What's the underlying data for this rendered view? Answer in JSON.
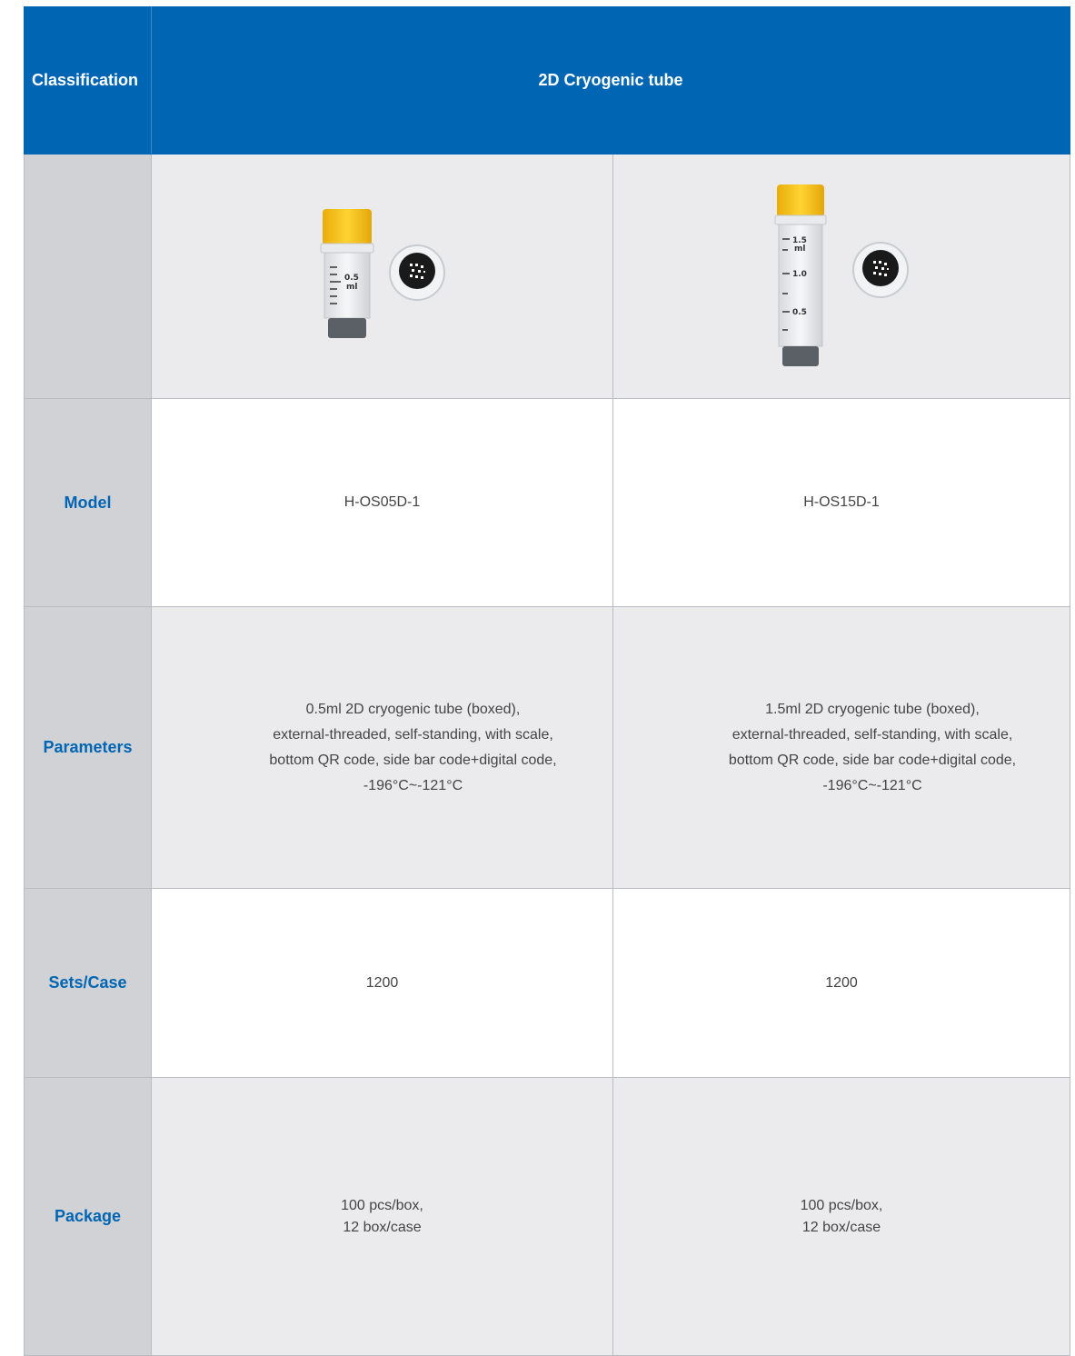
{
  "table": {
    "classification_label": "Classification",
    "product_title": "2D Cryogenic tube",
    "rows": {
      "model": {
        "label": "Model",
        "values": [
          "H-OS05D-1",
          "H-OS15D-1"
        ]
      },
      "parameters": {
        "label": "Parameters",
        "values": [
          "0.5ml 2D cryogenic tube (boxed),",
          "1.5ml 2D cryogenic tube (boxed),"
        ],
        "line2": "external-threaded, self-standing, with scale,",
        "line3": "bottom QR code, side bar code+digital code,",
        "line4": "-196°C~-121°C"
      },
      "sets_case": {
        "label": "Sets/Case",
        "values": [
          "1200",
          "1200"
        ]
      },
      "package": {
        "label": "Package",
        "line1": "100 pcs/box,",
        "line2": "12 box/case"
      }
    },
    "images": [
      {
        "icon": "cryogenic-tube-0.5ml-icon",
        "scale": [
          "0.5",
          "ml"
        ]
      },
      {
        "icon": "cryogenic-tube-1.5ml-icon",
        "scale": [
          "1.5",
          "ml",
          "1.0",
          "0.5"
        ]
      }
    ],
    "colors": {
      "header_blue": "#0066b3",
      "label_grey": "#d0d2d6",
      "cell_grey": "#ebebed",
      "cap_yellow": "#f7c31c"
    }
  }
}
